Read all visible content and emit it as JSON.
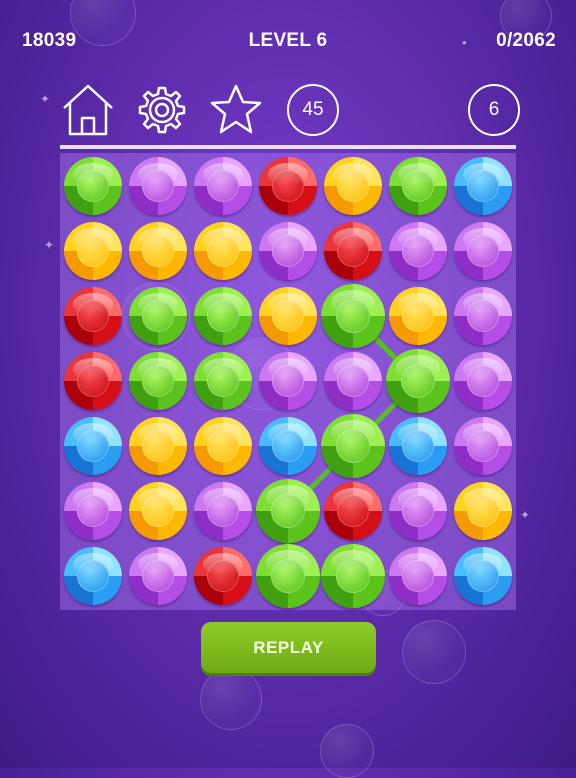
{
  "hud": {
    "score": "18039",
    "level": "LEVEL 6",
    "progress": "0/2062"
  },
  "toolbar": {
    "home_icon": "home-icon",
    "settings_icon": "gear-icon",
    "star_icon": "star-icon",
    "moves": "45",
    "count": "6"
  },
  "board": {
    "rows": 7,
    "cols": 7,
    "gems": [
      [
        "green",
        "purple",
        "purple",
        "red",
        "yellow",
        "green",
        "blue"
      ],
      [
        "yellow",
        "yellow",
        "yellow",
        "purple",
        "red",
        "purple",
        "purple"
      ],
      [
        "red",
        "green",
        "green",
        "yellow",
        "green",
        "yellow",
        "purple"
      ],
      [
        "red",
        "green",
        "green",
        "purple",
        "purple",
        "green",
        "purple"
      ],
      [
        "blue",
        "yellow",
        "yellow",
        "blue",
        "green",
        "blue",
        "purple"
      ],
      [
        "purple",
        "yellow",
        "purple",
        "green",
        "red",
        "purple",
        "yellow"
      ],
      [
        "blue",
        "purple",
        "red",
        "green",
        "green",
        "purple",
        "blue"
      ]
    ],
    "selected_path": [
      [
        2,
        4
      ],
      [
        3,
        5
      ],
      [
        4,
        4
      ],
      [
        5,
        3
      ],
      [
        6,
        3
      ],
      [
        6,
        4
      ]
    ],
    "colors": {
      "green": "#6fd624",
      "purple": "#bf5cec",
      "red": "#d8121a",
      "yellow": "#ffc40e",
      "blue": "#2ea6f5",
      "link": "#55c11c"
    }
  },
  "replay_button": "REPLAY"
}
